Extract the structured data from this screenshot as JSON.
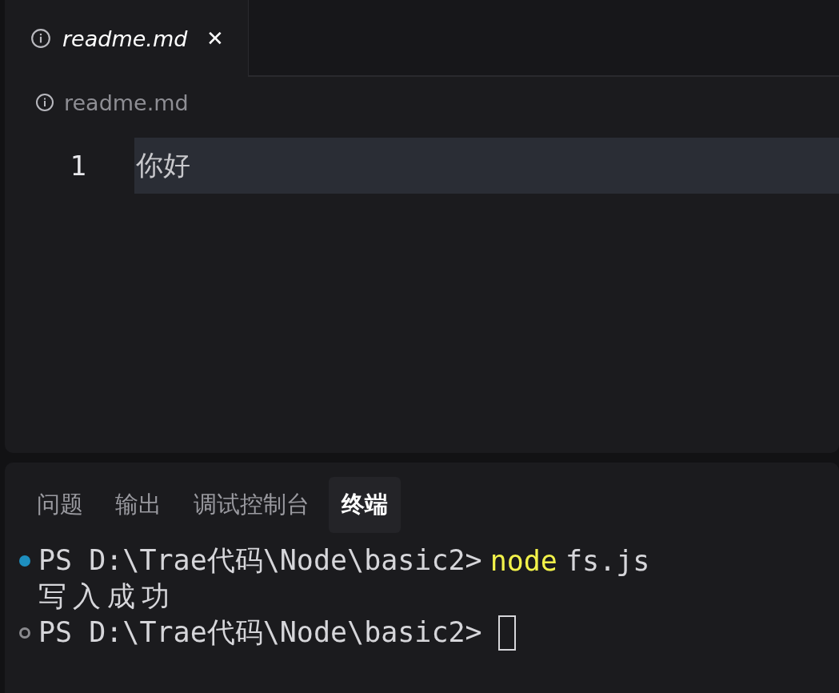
{
  "editor": {
    "tabs": [
      {
        "label": "readme.md",
        "selected": true,
        "italic": true,
        "close": "✕"
      }
    ],
    "breadcrumb": "readme.md",
    "lines": [
      {
        "number": "1",
        "text": "你好",
        "current": true
      }
    ]
  },
  "panel": {
    "tabs": [
      {
        "label": "问题",
        "selected": false
      },
      {
        "label": "输出",
        "selected": false
      },
      {
        "label": "调试控制台",
        "selected": false
      },
      {
        "label": "终端",
        "selected": true
      }
    ],
    "terminal": [
      {
        "kind": "command",
        "finished": true,
        "prompt": "PS D:\\Trae代码\\Node\\basic2>",
        "command": "node",
        "args": "fs.js"
      },
      {
        "kind": "output",
        "text": "写入成功"
      },
      {
        "kind": "command",
        "finished": false,
        "prompt": "PS D:\\Trae代码\\Node\\basic2>",
        "cursor": true
      }
    ]
  }
}
